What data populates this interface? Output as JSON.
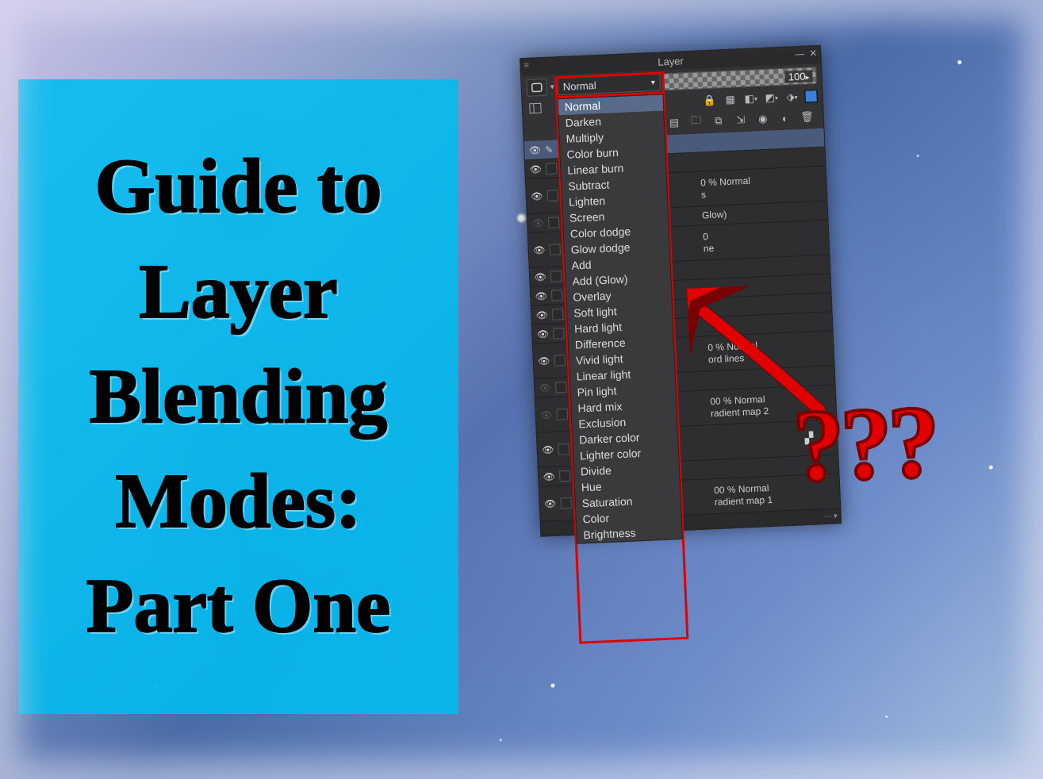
{
  "title": "Guide to Layer Blending Modes: Part One",
  "question_marks": "???",
  "panel": {
    "title": "Layer",
    "opacity": "100",
    "blend_mode_selected": "Normal",
    "blend_modes": [
      "Normal",
      "Darken",
      "Multiply",
      "Color burn",
      "Linear burn",
      "Subtract",
      "Lighten",
      "Screen",
      "Color dodge",
      "Glow dodge",
      "Add",
      "Add (Glow)",
      "Overlay",
      "Soft light",
      "Hard light",
      "Difference",
      "Vivid light",
      "Linear light",
      "Pin light",
      "Hard mix",
      "Exclusion",
      "Darker color",
      "Lighter color",
      "Divide",
      "Hue",
      "Saturation",
      "Color",
      "Brightness"
    ],
    "visible_layer_info": [
      {
        "text1": "0 % Normal",
        "text2": "s"
      },
      {
        "text1": "Glow)",
        "text2": ""
      },
      {
        "text1": "0",
        "text2": "ne"
      },
      {
        "text1": "0 % Normal",
        "text2": "ord lines"
      },
      {
        "text1": "00 % Normal",
        "text2": "radient map 2"
      },
      {
        "text1": "00 % Normal",
        "text2": "radient map 1"
      }
    ]
  }
}
